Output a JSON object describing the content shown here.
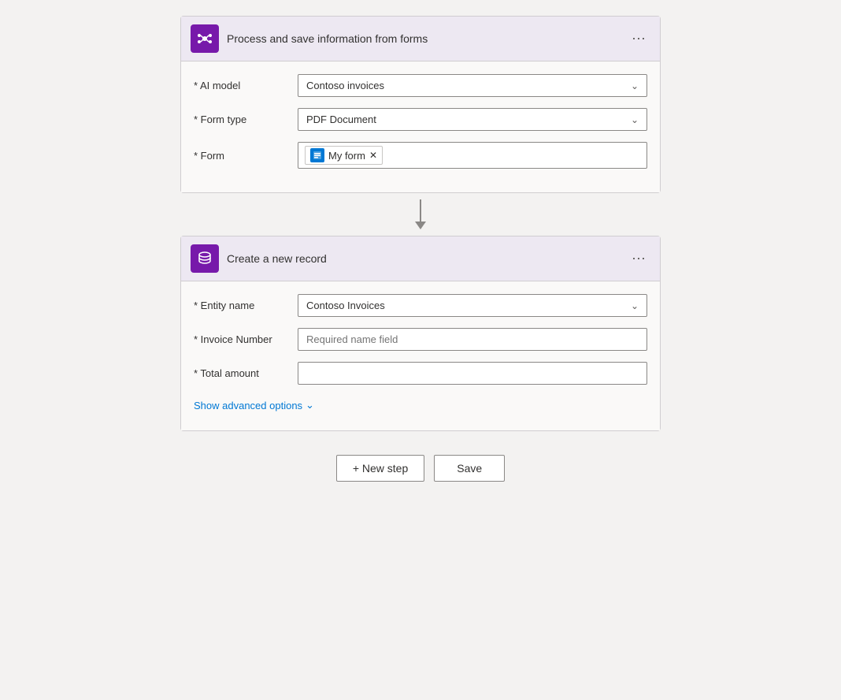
{
  "step1": {
    "title": "Process and save information from forms",
    "icon_bg": "#7719aa",
    "fields": {
      "ai_model_label": "* AI model",
      "ai_model_value": "Contoso invoices",
      "form_type_label": "* Form type",
      "form_type_value": "PDF Document",
      "form_label": "* Form",
      "form_tag_label": "My form"
    }
  },
  "step2": {
    "title": "Create a new record",
    "icon_bg": "#7719aa",
    "fields": {
      "entity_name_label": "* Entity name",
      "entity_name_value": "Contoso Invoices",
      "invoice_number_label": "* Invoice Number",
      "invoice_number_placeholder": "Required name field",
      "total_amount_label": "* Total amount",
      "total_amount_value": ""
    },
    "advanced_options_label": "Show advanced options"
  },
  "actions": {
    "new_step_label": "+ New step",
    "save_label": "Save"
  }
}
